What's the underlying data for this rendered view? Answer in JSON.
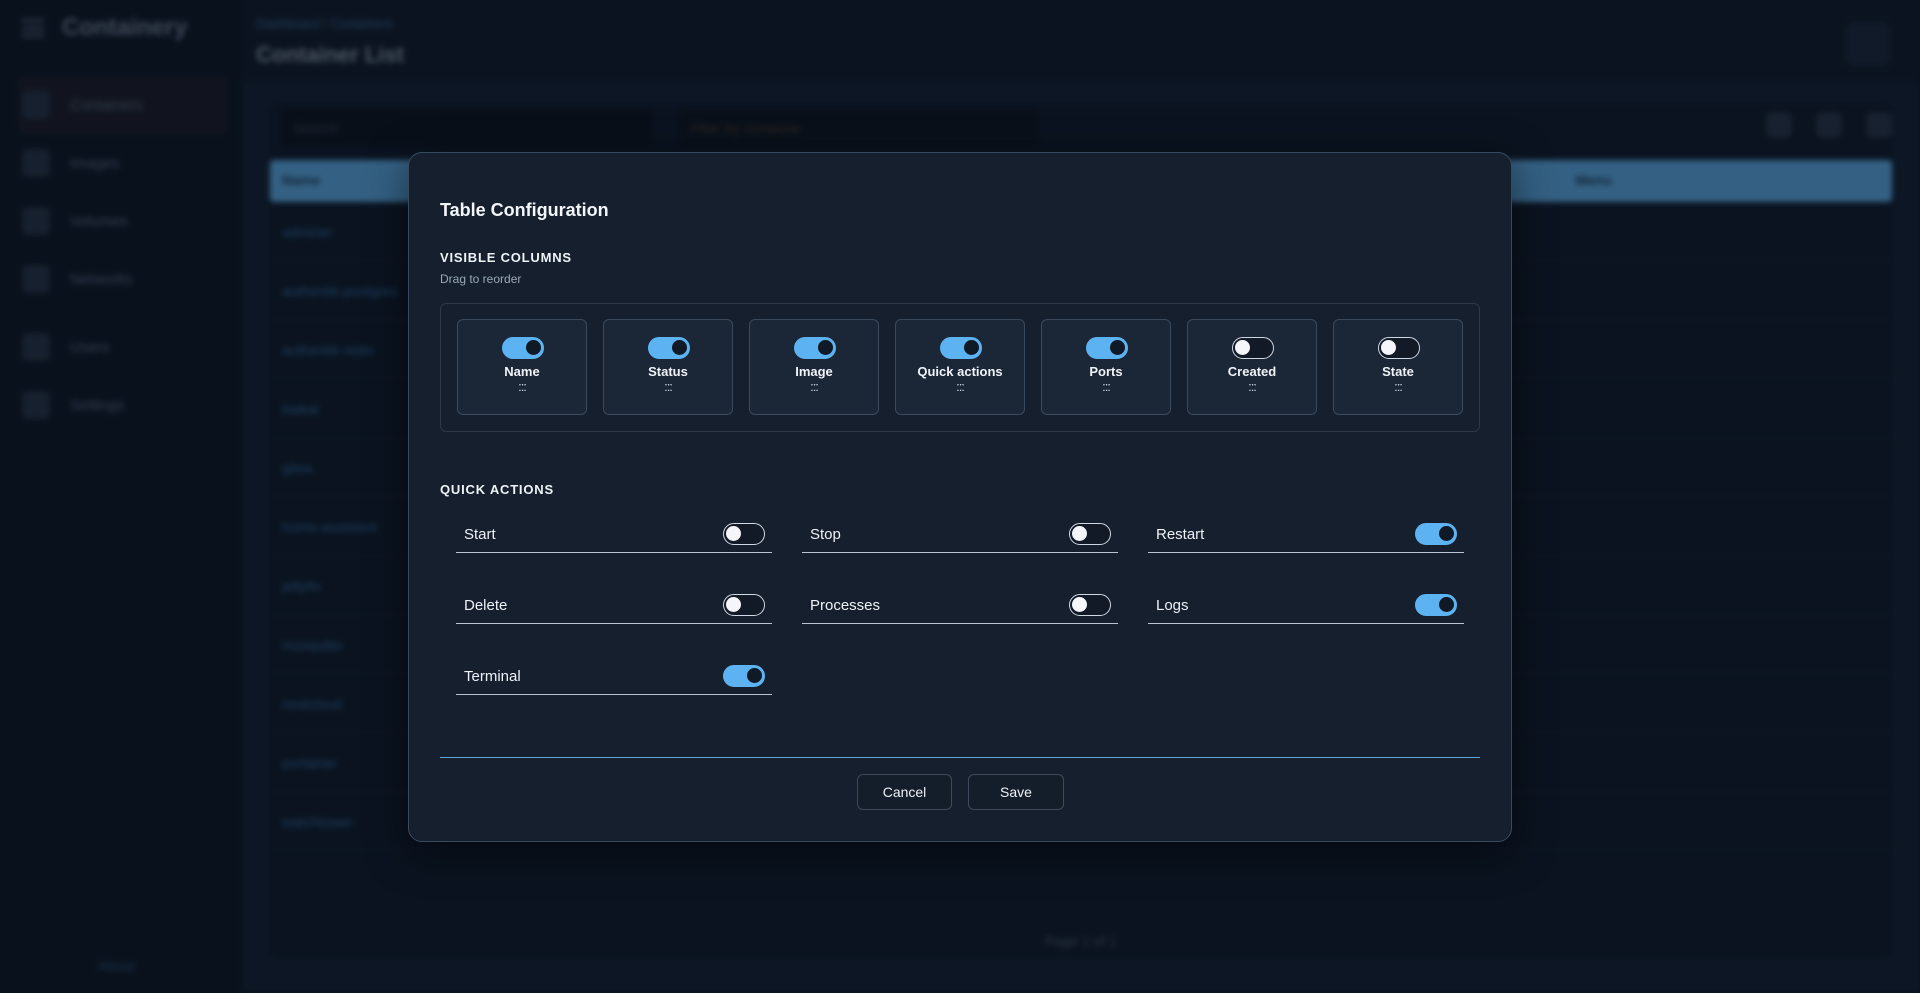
{
  "background": {
    "brand": "Containery",
    "nav": [
      {
        "label": "Containers"
      },
      {
        "label": "Images"
      },
      {
        "label": "Volumes"
      },
      {
        "label": "Networks"
      },
      {
        "label": "Users"
      },
      {
        "label": "Settings"
      }
    ],
    "sidebar_footer": "About",
    "breadcrumb": {
      "root": "Dashboard",
      "current": "Containers"
    },
    "page_title": "Container List",
    "search_placeholder": "Search",
    "filter_placeholder": "Filter by compose",
    "table_header": {
      "name": "Name",
      "menu": "Menu"
    },
    "rows": [
      {
        "name": "adminer"
      },
      {
        "name": "authentik-postgres"
      },
      {
        "name": "authentik-redis"
      },
      {
        "name": "baikal"
      },
      {
        "name": "gitea"
      },
      {
        "name": "home-assistant"
      },
      {
        "name": "jellyfin"
      },
      {
        "name": "mosquitto"
      },
      {
        "name": "nextcloud"
      },
      {
        "name": "portainer"
      },
      {
        "name": "watchtower"
      }
    ],
    "pager": "Page 1 of 1",
    "accent": "#5aa7df"
  },
  "modal": {
    "title": "Table Configuration",
    "visible_columns": {
      "heading": "VISIBLE COLUMNS",
      "hint": "Drag to reorder",
      "grip": ":::",
      "columns": [
        {
          "label": "Name",
          "enabled": true
        },
        {
          "label": "Status",
          "enabled": true
        },
        {
          "label": "Image",
          "enabled": true
        },
        {
          "label": "Quick actions",
          "enabled": true
        },
        {
          "label": "Ports",
          "enabled": true
        },
        {
          "label": "Created",
          "enabled": false
        },
        {
          "label": "State",
          "enabled": false
        }
      ]
    },
    "quick_actions": {
      "heading": "QUICK ACTIONS",
      "items": [
        {
          "label": "Start",
          "enabled": false
        },
        {
          "label": "Stop",
          "enabled": false
        },
        {
          "label": "Restart",
          "enabled": true
        },
        {
          "label": "Delete",
          "enabled": false
        },
        {
          "label": "Processes",
          "enabled": false
        },
        {
          "label": "Logs",
          "enabled": true
        },
        {
          "label": "Terminal",
          "enabled": true
        }
      ]
    },
    "cancel_label": "Cancel",
    "save_label": "Save",
    "toggle_on_color": "#5db3f1"
  }
}
